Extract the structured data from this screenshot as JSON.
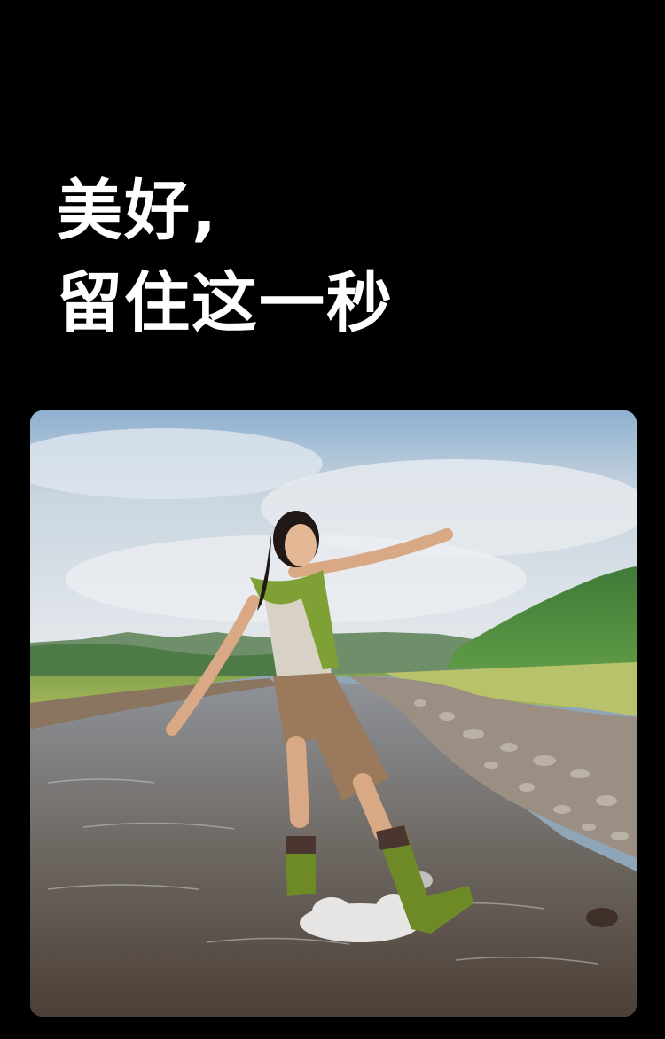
{
  "headline": {
    "line1": "美好,",
    "line2": "留住这一秒"
  },
  "colors": {
    "background": "#000000",
    "text": "#ffffff"
  }
}
